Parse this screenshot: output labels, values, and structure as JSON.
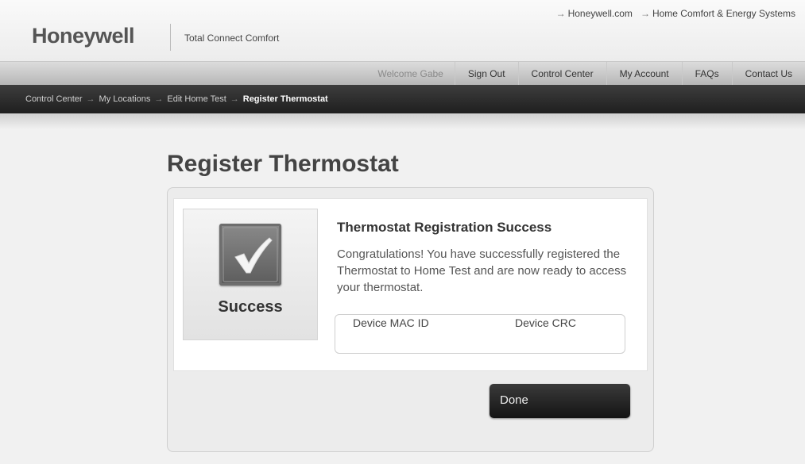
{
  "header": {
    "logo": "Honeywell",
    "tagline": "Total Connect Comfort",
    "top_links": [
      {
        "arrow": "→",
        "label": "Honeywell.com"
      },
      {
        "arrow": "→",
        "label": "Home Comfort & Energy Systems"
      }
    ]
  },
  "nav": {
    "welcome": "Welcome Gabe",
    "items": [
      "Sign Out",
      "Control Center",
      "My Account",
      "FAQs",
      "Contact Us"
    ]
  },
  "breadcrumb": {
    "items": [
      "Control Center",
      "My Locations",
      "Edit Home Test"
    ],
    "current": "Register Thermostat",
    "separator": "→"
  },
  "page": {
    "title": "Register Thermostat"
  },
  "result": {
    "icon": "checkmark-icon",
    "status_label": "Success",
    "title": "Thermostat Registration Success",
    "message": "Congratulations! You have successfully registered the Thermostat to Home Test and are now ready to access your thermostat.",
    "device_mac_label": "Device MAC ID",
    "device_crc_label": "Device CRC"
  },
  "actions": {
    "done_label": "Done"
  }
}
